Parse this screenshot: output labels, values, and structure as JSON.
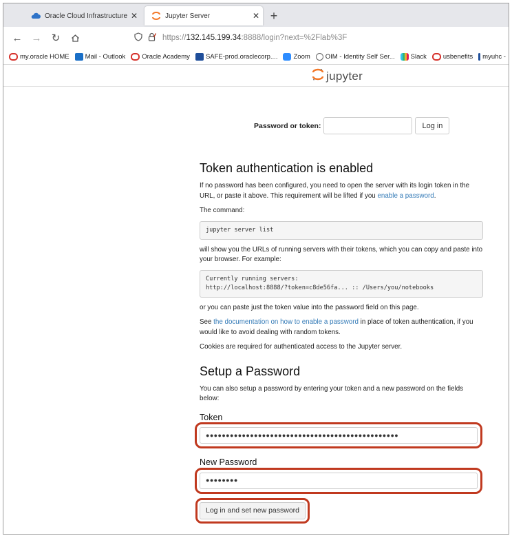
{
  "browser": {
    "tabs": [
      {
        "title": "Oracle Cloud Infrastructure | Si",
        "icon": "cloud-icon"
      },
      {
        "title": "Jupyter Server",
        "icon": "jupyter-icon",
        "close": "✕"
      }
    ],
    "first_tab_close": "✕",
    "new_tab": "+",
    "url_prefix": "https://",
    "url_host": "132.145.199.34",
    "url_rest": ":8888/login?next=%2Flab%3F",
    "bookmarks": [
      {
        "label": "my.oracle HOME",
        "color": "#d6302a"
      },
      {
        "label": "Mail - Outlook",
        "color": "#1a6fc7"
      },
      {
        "label": "Oracle Academy",
        "color": "#d6302a"
      },
      {
        "label": "SAFE-prod.oraclecorp....",
        "color": "#1f4e9a"
      },
      {
        "label": "Zoom",
        "color": "#2d8cff"
      },
      {
        "label": "OIM - Identity Self Ser...",
        "color": "#666666"
      },
      {
        "label": "Slack",
        "color": "#e0a020"
      },
      {
        "label": "usbenefits",
        "color": "#d6302a"
      },
      {
        "label": "myuhc -",
        "color": "#1f4e9a"
      }
    ]
  },
  "jupyter": {
    "logo_text": "jupyter",
    "login_label": "Password or token:",
    "login_button": "Log in",
    "token_heading": "Token authentication is enabled",
    "p1_before": "If no password has been configured, you need to open the server with its login token in the URL, or paste it above. This requirement will be lifted if you ",
    "p1_link": "enable a password",
    "p1_after": ".",
    "p2": "The command:",
    "code1": "jupyter server list",
    "p3": "will show you the URLs of running servers with their tokens, which you can copy and paste into your browser. For example:",
    "code2": "Currently running servers:\nhttp://localhost:8888/?token=c8de56fa... :: /Users/you/notebooks",
    "p4": "or you can paste just the token value into the password field on this page.",
    "p5_before": "See ",
    "p5_link": "the documentation on how to enable a password",
    "p5_after": " in place of token authentication, if you would like to avoid dealing with random tokens.",
    "p6": "Cookies are required for authenticated access to the Jupyter server.",
    "setup_heading": "Setup a Password",
    "setup_text": "You can also setup a password by entering your token and a new password on the fields below:",
    "token_label": "Token",
    "token_value": "●●●●●●●●●●●●●●●●●●●●●●●●●●●●●●●●●●●●●●●●●●●●●●●●",
    "newpw_label": "New Password",
    "newpw_value": "●●●●●●●●",
    "set_button": "Log in and set new password"
  }
}
